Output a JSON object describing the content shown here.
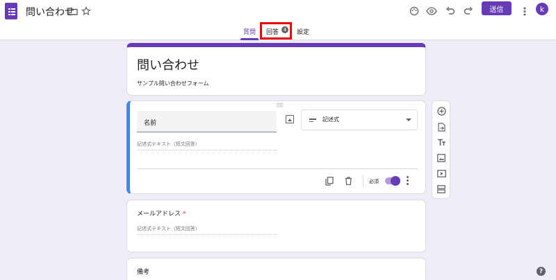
{
  "header": {
    "form_title": "問い合わせ",
    "send_label": "送信",
    "avatar_letter": "k"
  },
  "tabs": [
    {
      "label": "質問",
      "active": true
    },
    {
      "label": "回答",
      "active": false
    },
    {
      "label": "設定",
      "active": false
    }
  ],
  "response_count": "4",
  "title_card": {
    "title": "問い合わせ",
    "description": "サンプル問い合わせフォーム"
  },
  "question1": {
    "title": "名前",
    "type_label": "記述式",
    "answer_placeholder": "記述式テキスト（短文回答）",
    "required_label": "必須",
    "required": true
  },
  "question2": {
    "title": "メールアドレス",
    "required_mark": "*",
    "answer_placeholder": "記述式テキスト（短文回答）"
  },
  "question3": {
    "title": "備考"
  },
  "colors": {
    "accent": "#673ab7",
    "focus_bar": "#4285f4",
    "highlight": "#e00000",
    "background": "#efebf7"
  },
  "icons": {
    "header": [
      "folder-icon",
      "star-icon",
      "palette-icon",
      "preview-icon",
      "undo-icon",
      "redo-icon",
      "more-vert-icon"
    ],
    "side_toolbar": [
      "add-question-icon",
      "import-questions-icon",
      "add-title-icon",
      "add-image-icon",
      "add-video-icon",
      "add-section-icon"
    ],
    "question_footer": [
      "duplicate-icon",
      "delete-icon",
      "more-vert-icon"
    ]
  }
}
